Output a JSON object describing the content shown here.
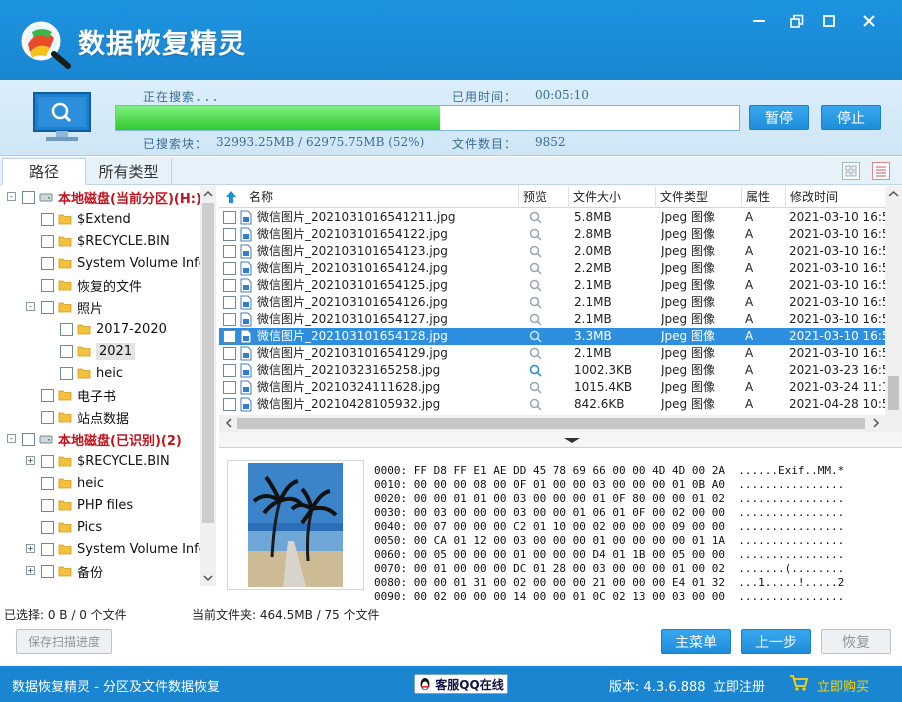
{
  "app": {
    "title": "数据恢复精灵"
  },
  "progress": {
    "searching_label": "正在搜索...",
    "elapsed_label": "已用时间：",
    "elapsed_value": "00:05:10",
    "scanned_label": "已搜索块：",
    "scanned_value": "32993.25MB / 62975.75MB (52%)",
    "percent": 52,
    "count_label": "文件数目：",
    "count_value": "9852",
    "pause_label": "暂停",
    "stop_label": "停止"
  },
  "tabs": [
    "路径",
    "所有类型"
  ],
  "tree": [
    {
      "label": "本地磁盘(当前分区)(H:)",
      "disk": true
    },
    {
      "label": "$Extend"
    },
    {
      "label": "$RECYCLE.BIN"
    },
    {
      "label": "System Volume Infc"
    },
    {
      "label": "恢复的文件"
    },
    {
      "label": "照片"
    },
    {
      "label": "2017-2020"
    },
    {
      "label": "2021"
    },
    {
      "label": "heic"
    },
    {
      "label": "电子书"
    },
    {
      "label": "站点数据"
    },
    {
      "label": "本地磁盘(已识别)(2)",
      "disk": true
    },
    {
      "label": "$RECYCLE.BIN"
    },
    {
      "label": "heic"
    },
    {
      "label": "PHP files"
    },
    {
      "label": "Pics"
    },
    {
      "label": "System Volume Infc"
    },
    {
      "label": "备份"
    }
  ],
  "list": {
    "headers": [
      "名称",
      "预览",
      "文件大小",
      "文件类型",
      "属性",
      "修改时间"
    ],
    "rows": [
      {
        "name": "微信图片_202103101654121​1.jpg",
        "size": "5.8MB",
        "type": "Jpeg 图像",
        "attr": "A",
        "time": "2021-03-10 16:5"
      },
      {
        "name": "微信图片_202103101654122.jpg",
        "size": "2.8MB",
        "type": "Jpeg 图像",
        "attr": "A",
        "time": "2021-03-10 16:5"
      },
      {
        "name": "微信图片_202103101654123.jpg",
        "size": "2.0MB",
        "type": "Jpeg 图像",
        "attr": "A",
        "time": "2021-03-10 16:5"
      },
      {
        "name": "微信图片_202103101654124.jpg",
        "size": "2.2MB",
        "type": "Jpeg 图像",
        "attr": "A",
        "time": "2021-03-10 16:5"
      },
      {
        "name": "微信图片_202103101654125.jpg",
        "size": "2.1MB",
        "type": "Jpeg 图像",
        "attr": "A",
        "time": "2021-03-10 16:5"
      },
      {
        "name": "微信图片_202103101654126.jpg",
        "size": "2.1MB",
        "type": "Jpeg 图像",
        "attr": "A",
        "time": "2021-03-10 16:5"
      },
      {
        "name": "微信图片_202103101654127.jpg",
        "size": "2.1MB",
        "type": "Jpeg 图像",
        "attr": "A",
        "time": "2021-03-10 16:5"
      },
      {
        "name": "微信图片_202103101654128.jpg",
        "size": "3.3MB",
        "type": "Jpeg 图像",
        "attr": "A",
        "time": "2021-03-10 16:5",
        "selected": true
      },
      {
        "name": "微信图片_202103101654129.jpg",
        "size": "2.1MB",
        "type": "Jpeg 图像",
        "attr": "A",
        "time": "2021-03-10 16:5"
      },
      {
        "name": "微信图片_20210323165258.jpg",
        "size": "1002.3KB",
        "type": "Jpeg 图像",
        "attr": "A",
        "time": "2021-03-23 16:5"
      },
      {
        "name": "微信图片_20210324111628.jpg",
        "size": "1015.4KB",
        "type": "Jpeg 图像",
        "attr": "A",
        "time": "2021-03-24 11:1"
      },
      {
        "name": "微信图片_20210428105932.jpg",
        "size": "842.6KB",
        "type": "Jpeg 图像",
        "attr": "A",
        "time": "2021-04-28 10:5"
      }
    ]
  },
  "hex": [
    "0000: FF D8 FF E1 AE DD 45 78 69 66 00 00 4D 4D 00 2A  ......Exif..MM.*",
    "0010: 00 00 00 08 00 0F 01 00 00 03 00 00 00 01 0B A0  ................",
    "0020: 00 00 01 01 00 03 00 00 00 01 0F 80 00 00 01 02  ................",
    "0030: 00 03 00 00 00 03 00 00 01 06 01 0F 00 02 00 00  ................",
    "0040: 00 07 00 00 00 C2 01 10 00 02 00 00 00 09 00 00  ................",
    "0050: 00 CA 01 12 00 03 00 00 00 01 00 00 00 00 01 1A  ................",
    "0060: 00 05 00 00 00 01 00 00 00 D4 01 1B 00 05 00 00  ................",
    "0070: 00 01 00 00 00 DC 01 28 00 03 00 00 00 01 00 02  .......(........",
    "0080: 00 00 01 31 00 02 00 00 00 21 00 00 00 E4 01 32  ...1.....!.....2",
    "0090: 00 02 00 00 00 14 00 00 01 0C 02 13 00 03 00 00  ................"
  ],
  "status": {
    "selected": "已选择: 0 B / 0 个文件",
    "current_folder": "当前文件夹:  464.5MB / 75 个文件"
  },
  "buttons": {
    "save_progress": "保存扫描进度",
    "main_menu": "主菜单",
    "prev_step": "上一步",
    "recover": "恢复"
  },
  "footer": {
    "tagline": "数据恢复精灵 - 分区及文件数据恢复",
    "qq": "客服QQ在线",
    "version": "版本: 4.3.6.888",
    "register": "立即注册",
    "buy": "立即购买"
  },
  "colors": {
    "brand_blue": "#1a86d2",
    "selection": "#2e8fe0",
    "progress_green": "#2fcb2f",
    "disk_label_red": "#c1141c"
  }
}
